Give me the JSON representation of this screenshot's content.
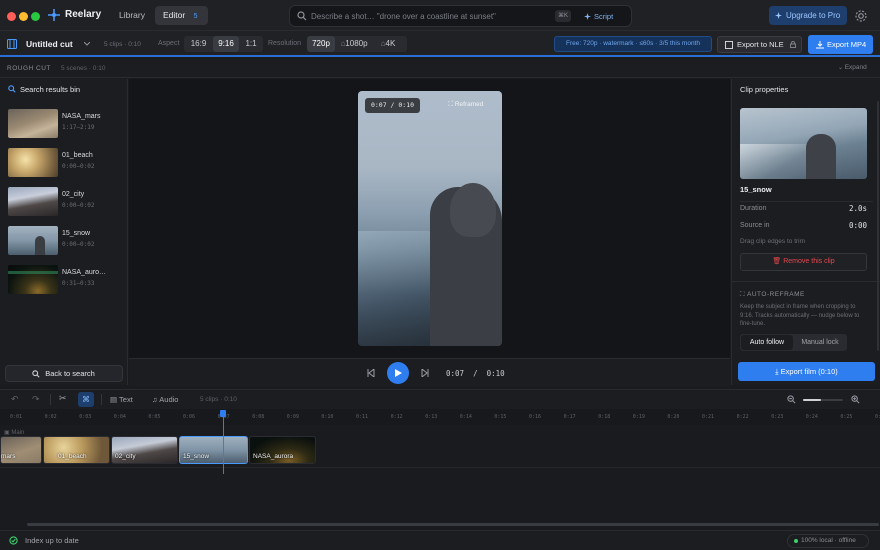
{
  "app": {
    "name": "Reelary",
    "tabs": [
      {
        "label": "Library"
      },
      {
        "label": "Editor",
        "badge": "5"
      }
    ]
  },
  "search": {
    "placeholder": "Describe a shot… \"drone over a coastline at sunset\"",
    "shortcut": "⌘K",
    "script_label": "Script"
  },
  "header": {
    "upgrade_label": "Upgrade to Pro"
  },
  "toolbar": {
    "project_title": "Untitled cut",
    "clips_summary": "5 clips · 0:10",
    "aspect_label": "Aspect",
    "aspect_options": [
      "16:9",
      "9:16",
      "1:1"
    ],
    "aspect_selected": "9:16",
    "resolution_label": "Resolution",
    "resolution_options": [
      "720p",
      "1080p",
      "4K"
    ],
    "resolution_selected": "720p",
    "free_badge": "Free: 720p · watermark · ≤60s · 3/5 this month",
    "export_nle": "Export to NLE",
    "export_mp4": "Export MP4"
  },
  "roughcut": {
    "title": "ROUGH CUT",
    "scenes": "5 scenes · 0:10",
    "expand": "Expand"
  },
  "bin": {
    "title": "Search results bin",
    "clips": [
      {
        "name": "NASA_mars",
        "time": "1:17–2:19"
      },
      {
        "name": "01_beach",
        "time": "0:00–0:02"
      },
      {
        "name": "02_city",
        "time": "0:00–0:02"
      },
      {
        "name": "15_snow",
        "time": "0:00–0:02"
      },
      {
        "name": "NASA_auro…",
        "time": "0:31–0:33"
      }
    ],
    "back_label": "Back to search"
  },
  "preview": {
    "timecode": "0:07 / 0:10",
    "reframed": "Reframed"
  },
  "transport": {
    "timecode": "0:07  /  0:10"
  },
  "properties": {
    "title": "Clip properties",
    "clip_name": "15_snow",
    "duration_label": "Duration",
    "duration_value": "2.0s",
    "source_label": "Source in",
    "source_value": "0:00",
    "hint": "Drag clip edges to trim",
    "remove_label": "Remove this clip",
    "reframe_title": "AUTO-REFRAME",
    "reframe_desc": "Keep the subject in frame when cropping to 9:16. Tracks automatically — nudge below to fine-tune.",
    "modes": [
      "Auto follow",
      "Manual lock"
    ],
    "export_label": "Export film (0:10)"
  },
  "timeline": {
    "text_label": "Text",
    "audio_label": "Audio",
    "summary": "5 clips · 0:10",
    "track_label": "Main",
    "ticks": [
      "0:01",
      "0:02",
      "0:03",
      "0:04",
      "0:05",
      "0:06",
      "0:07",
      "0:08",
      "0:09",
      "0:10",
      "0:11",
      "0:12",
      "0:13",
      "0:14",
      "0:15",
      "0:16",
      "0:17",
      "0:18",
      "0:19",
      "0:20",
      "0:21",
      "0:22",
      "0:23",
      "0:24",
      "0:25",
      "0:26"
    ],
    "clips": [
      "mars",
      "01_beach",
      "02_city",
      "15_snow",
      "NASA_aurora"
    ]
  },
  "status": {
    "left": "Index up to date",
    "right": "100% local · offline"
  },
  "colors": {
    "accent": "#2f7ef0",
    "danger": "#e5484d",
    "success": "#3ecf6e"
  }
}
